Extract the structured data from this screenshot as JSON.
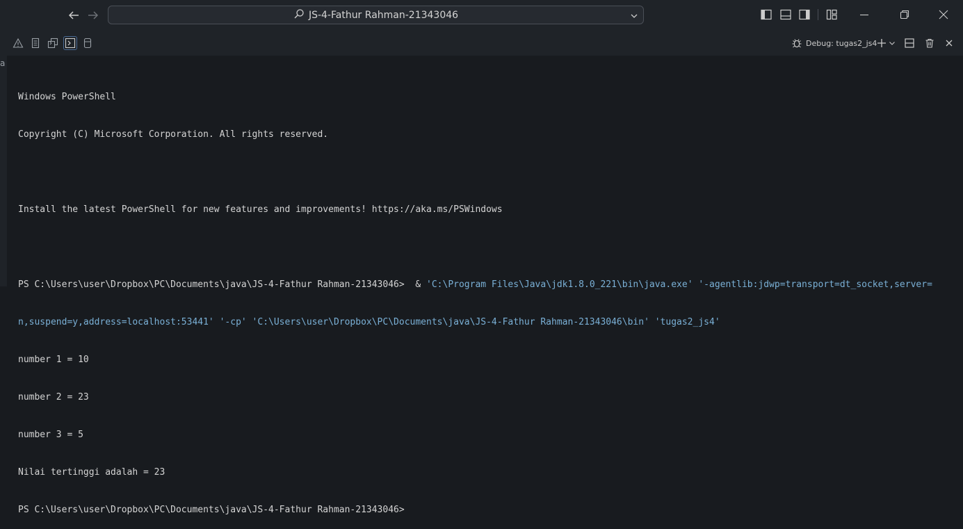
{
  "titlebar": {
    "search_text": "JS-4-Fathur Rahman-21343046",
    "icons": [
      "back-arrow-icon",
      "forward-arrow-icon",
      "search-icon",
      "chevron-down-icon",
      "toggle-primary-sidebar-icon",
      "toggle-panel-icon",
      "toggle-secondary-sidebar-icon",
      "customize-layout-icon",
      "minimize-icon",
      "restore-icon",
      "close-icon"
    ]
  },
  "left_edge_text": "a",
  "panel": {
    "tabs": [
      "problems-icon",
      "output-icon",
      "debug-console-icon",
      "terminal-icon",
      "ports-icon"
    ],
    "active_tab": "terminal-icon",
    "debug_label": "Debug: tugas2_js4",
    "actions": [
      "new-terminal-icon",
      "split-terminal-icon",
      "kill-terminal-icon",
      "close-panel-icon"
    ]
  },
  "terminal": {
    "line1": "Windows PowerShell",
    "line2": "Copyright (C) Microsoft Corporation. All rights reserved.",
    "line3": "",
    "line4": "Install the latest PowerShell for new features and improvements! https://aka.ms/PSWindows",
    "line5": "",
    "line6_prompt": "PS C:\\Users\\user\\Dropbox\\PC\\Documents\\java\\JS-4-Fathur Rahman-21343046> ",
    "line6_amp": " & ",
    "line6_args": "'C:\\Program Files\\Java\\jdk1.8.0_221\\bin\\java.exe' '-agentlib:jdwp=transport=dt_socket,server=",
    "line7_args": "n,suspend=y,address=localhost:53441' '-cp' 'C:\\Users\\user\\Dropbox\\PC\\Documents\\java\\JS-4-Fathur Rahman-21343046\\bin' 'tugas2_js4'",
    "line8": "number 1 = 10",
    "line9": "number 2 = 23",
    "line10": "number 3 = 5",
    "line11": "Nilai tertinggi adalah = 23",
    "line12": "PS C:\\Users\\user\\Dropbox\\PC\\Documents\\java\\JS-4-Fathur Rahman-21343046>"
  },
  "colors": {
    "background": "#181b1f",
    "chrome": "#1f2328",
    "text": "#d4d4d4",
    "argument": "#7ab0d6"
  }
}
